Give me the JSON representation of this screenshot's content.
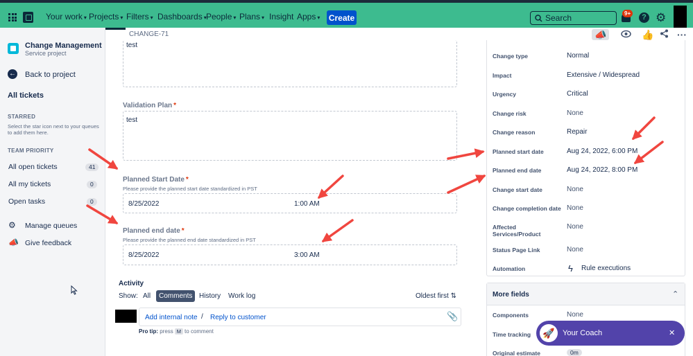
{
  "nav": {
    "items": [
      {
        "label": "Your work",
        "chevron": true
      },
      {
        "label": "Projects",
        "chevron": true,
        "active": true
      },
      {
        "label": "Filters",
        "chevron": true
      },
      {
        "label": "Dashboards",
        "chevron": true
      },
      {
        "label": "People",
        "chevron": true
      },
      {
        "label": "Plans",
        "chevron": true
      },
      {
        "label": "Insight",
        "chevron": false
      },
      {
        "label": "Apps",
        "chevron": true
      }
    ],
    "create_label": "Create",
    "search_placeholder": "Search",
    "notifications_badge": "9+",
    "help_glyph": "?"
  },
  "sidebar": {
    "project_name": "Change Management",
    "project_type": "Service project",
    "back_label": "Back to project",
    "all_tickets": "All tickets",
    "starred_label": "STARRED",
    "starred_note": "Select the star icon next to your queues to add them here.",
    "team_priority_label": "TEAM PRIORITY",
    "queues": [
      {
        "label": "All open tickets",
        "count": "41"
      },
      {
        "label": "All my tickets",
        "count": "0"
      },
      {
        "label": "Open tasks",
        "count": "0"
      }
    ],
    "manage_queues": "Manage queues",
    "give_feedback": "Give feedback"
  },
  "header": {
    "breadcrumb": "CHANGE-71"
  },
  "main": {
    "top_field_value": "test",
    "validation_plan": {
      "label": "Validation Plan",
      "required": "*",
      "value": "test"
    },
    "planned_start": {
      "label": "Planned Start Date",
      "required": "*",
      "help": "Please provide the planned start date standardized in PST",
      "date": "8/25/2022",
      "time": "1:00 AM"
    },
    "planned_end": {
      "label": "Planned end date",
      "required": "*",
      "help": "Please provide the planned end date standardized in PST",
      "date": "8/25/2022",
      "time": "3:00 AM"
    },
    "activity": {
      "title": "Activity",
      "show_label": "Show:",
      "filters": [
        "All",
        "Comments",
        "History",
        "Work log"
      ],
      "selected": "Comments",
      "sort_label": "Oldest first",
      "add_internal_note": "Add internal note",
      "separator": "/",
      "reply_to_customer": "Reply to customer",
      "protip_prefix": "Pro tip:",
      "protip_press": "press",
      "protip_key": "M",
      "protip_suffix": "to comment"
    }
  },
  "details": {
    "rows": [
      {
        "label": "Change type",
        "value": "Normal"
      },
      {
        "label": "Impact",
        "value": "Extensive / Widespread"
      },
      {
        "label": "Urgency",
        "value": "Critical"
      },
      {
        "label": "Change risk",
        "value": "None"
      },
      {
        "label": "Change reason",
        "value": "Repair"
      },
      {
        "label": "Planned start date",
        "value": "Aug 24, 2022, 6:00 PM"
      },
      {
        "label": "Planned end date",
        "value": "Aug 24, 2022, 8:00 PM"
      },
      {
        "label": "Change start date",
        "value": "None"
      },
      {
        "label": "Change completion date",
        "value": "None"
      },
      {
        "label": "Affected Services/Product",
        "value": "None"
      },
      {
        "label": "Status Page Link",
        "value": "None"
      },
      {
        "label": "Automation",
        "value": "Rule executions"
      }
    ],
    "more_fields": {
      "title": "More fields",
      "rows": [
        {
          "label": "Components",
          "value": "None"
        },
        {
          "label": "Time tracking",
          "value": ""
        },
        {
          "label": "Original estimate",
          "value": "0m"
        }
      ]
    }
  },
  "coach": {
    "label": "Your Coach",
    "close": "✕"
  },
  "colors": {
    "nav_bg": "#3dbb8f",
    "primary": "#0052cc",
    "required": "#de350b",
    "annotation_arrow": "#f0463f",
    "coach_bg": "#5243aa"
  }
}
